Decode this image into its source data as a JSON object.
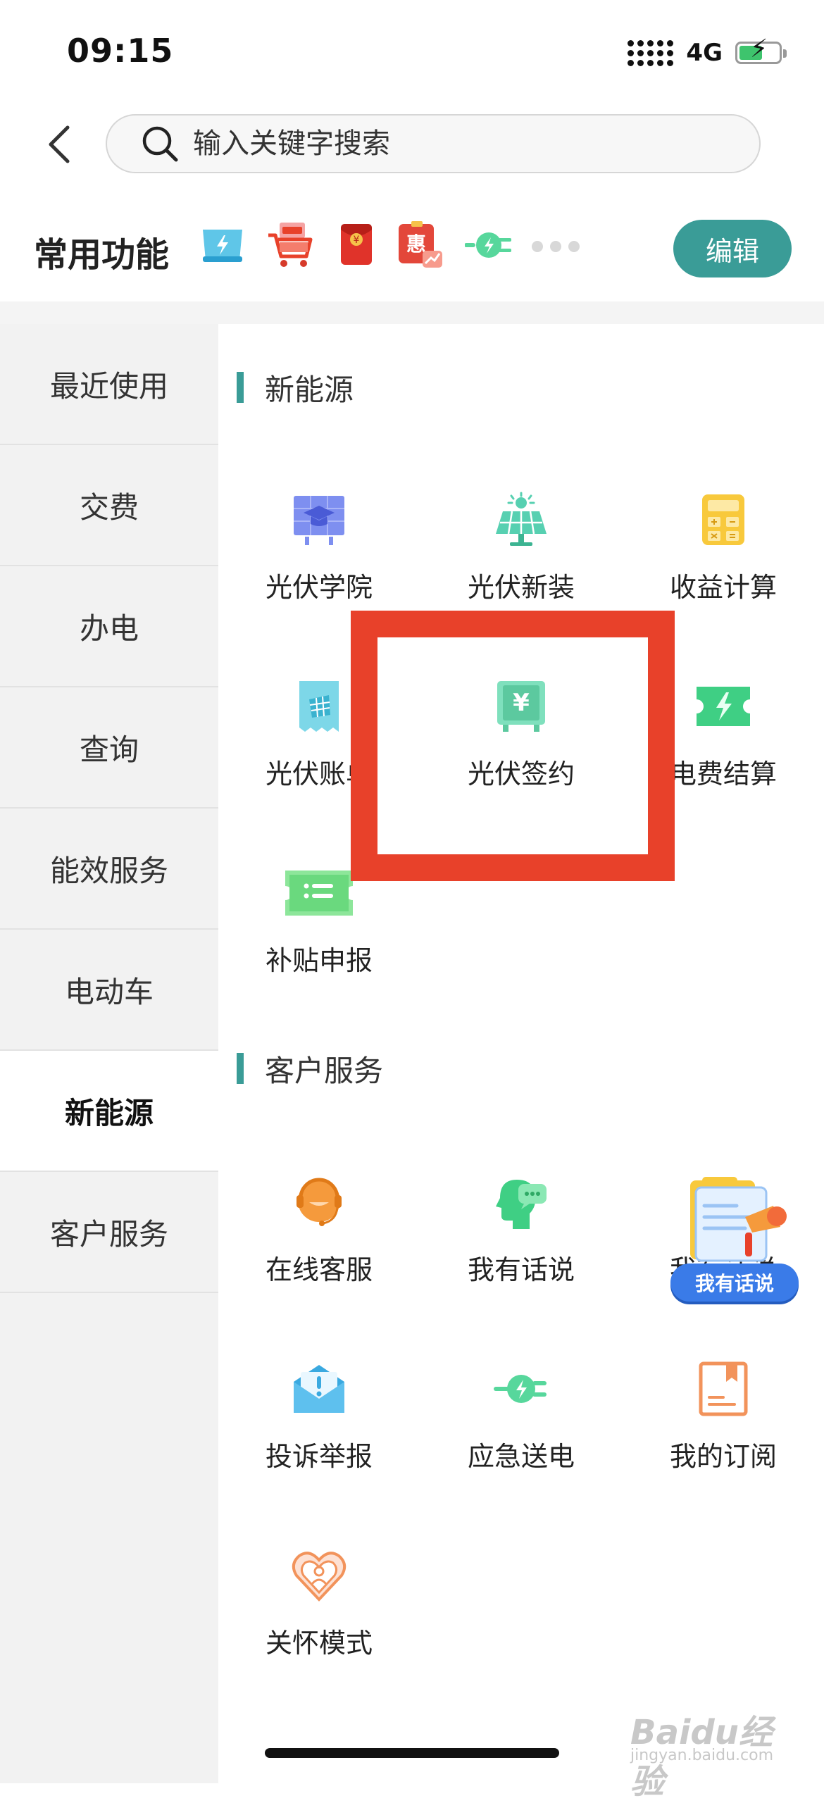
{
  "status_bar": {
    "time": "09:15",
    "network": "4G"
  },
  "search": {
    "placeholder": "输入关键字搜索"
  },
  "common_functions": {
    "title": "常用功能",
    "edit_label": "编辑",
    "shortcut_icons": [
      "electric-bill-icon",
      "recharge-cart-icon",
      "red-envelope-icon",
      "discount-icon",
      "power-plug-icon"
    ]
  },
  "sidebar": {
    "items": [
      {
        "label": "最近使用"
      },
      {
        "label": "交费"
      },
      {
        "label": "办电"
      },
      {
        "label": "查询"
      },
      {
        "label": "能效服务"
      },
      {
        "label": "电动车"
      },
      {
        "label": "新能源",
        "active": true
      },
      {
        "label": "客户服务"
      }
    ]
  },
  "sections": [
    {
      "title": "新能源",
      "items": [
        {
          "label": "光伏学院",
          "icon": "solar-academy-icon"
        },
        {
          "label": "光伏新装",
          "icon": "solar-panel-icon"
        },
        {
          "label": "收益计算",
          "icon": "calculator-icon"
        },
        {
          "label": "光伏账单",
          "icon": "bill-icon"
        },
        {
          "label": "光伏签约",
          "icon": "contract-yuan-icon"
        },
        {
          "label": "电费结算",
          "icon": "settlement-icon"
        },
        {
          "label": "补贴申报",
          "icon": "subsidy-ticket-icon"
        }
      ]
    },
    {
      "title": "客户服务",
      "items": [
        {
          "label": "在线客服",
          "icon": "headset-icon"
        },
        {
          "label": "我有话说",
          "icon": "chat-head-icon"
        },
        {
          "label": "我有话说",
          "icon": "feedback-icon"
        },
        {
          "label": "投诉举报",
          "icon": "complaint-mail-icon"
        },
        {
          "label": "应急送电",
          "icon": "power-plug-icon"
        },
        {
          "label": "我的订阅",
          "icon": "subscription-book-icon"
        },
        {
          "label": "关怀模式",
          "icon": "care-heart-icon"
        }
      ]
    }
  ],
  "promo_badge": {
    "label": "我有话说"
  },
  "watermark": {
    "brand": "Baidu经验",
    "url": "jingyan.baidu.com"
  },
  "colors": {
    "accent": "#3a9c97",
    "highlight": "#e8412a",
    "sidebar_bg": "#f2f2f2"
  }
}
